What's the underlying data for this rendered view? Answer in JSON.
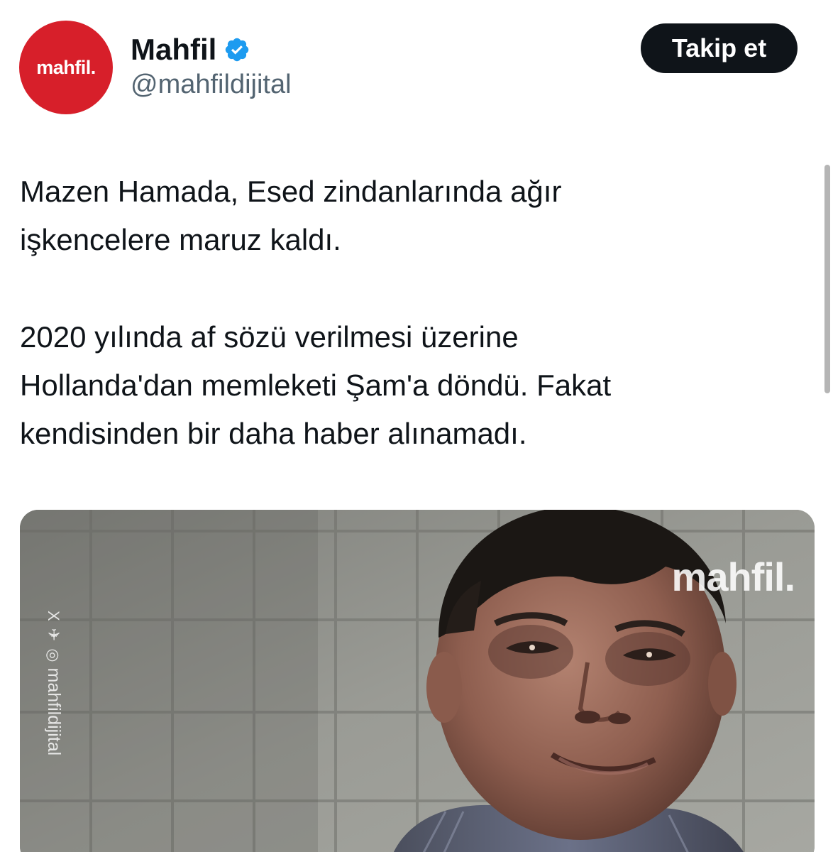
{
  "account": {
    "display_name": "Mahfil",
    "handle": "@mahfildijital",
    "avatar_text": "mahfil.",
    "verified": true,
    "brand_color": "#d71f2a",
    "verified_color": "#1d9bf0"
  },
  "actions": {
    "follow_label": "Takip et"
  },
  "tweet": {
    "paragraph_1": "Mazen Hamada, Esed zindanlarında ağır\nişkencelere maruz kaldı.",
    "paragraph_2": "2020 yılında af sözü verilmesi üzerine\nHollanda'dan memleketi Şam'a döndü. Fakat\nkendisinden bir daha haber alınamadı."
  },
  "media": {
    "watermark": "mahfil.",
    "side_credit": "mahfildijital",
    "side_credit_icons": "X ✈ ◎"
  }
}
